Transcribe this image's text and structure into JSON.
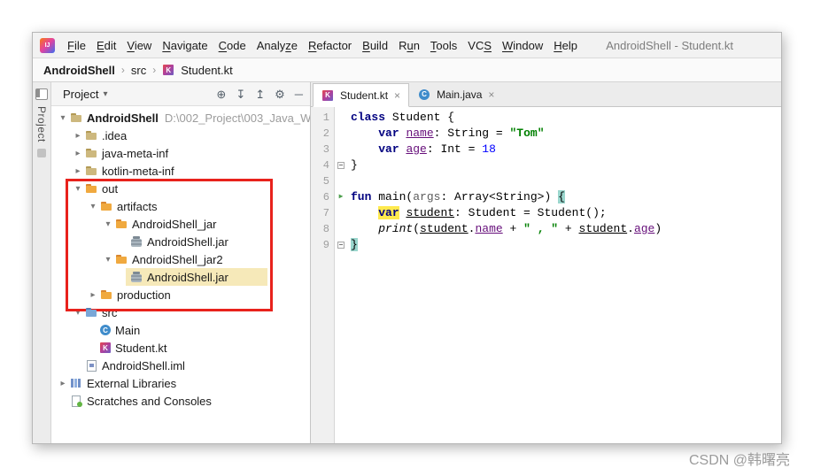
{
  "window": {
    "title": "AndroidShell - Student.kt",
    "logo_text": "IJ"
  },
  "menu": {
    "items": [
      {
        "label": "File",
        "mnemonic": 0
      },
      {
        "label": "Edit",
        "mnemonic": 0
      },
      {
        "label": "View",
        "mnemonic": 0
      },
      {
        "label": "Navigate",
        "mnemonic": 0
      },
      {
        "label": "Code",
        "mnemonic": 0
      },
      {
        "label": "Analyze",
        "mnemonic": 5
      },
      {
        "label": "Refactor",
        "mnemonic": 0
      },
      {
        "label": "Build",
        "mnemonic": 0
      },
      {
        "label": "Run",
        "mnemonic": 1
      },
      {
        "label": "Tools",
        "mnemonic": 0
      },
      {
        "label": "VCS",
        "mnemonic": 2
      },
      {
        "label": "Window",
        "mnemonic": 0
      },
      {
        "label": "Help",
        "mnemonic": 0
      }
    ]
  },
  "breadcrumb": {
    "separator": "›",
    "items": [
      {
        "label": "AndroidShell",
        "bold": true
      },
      {
        "label": "src"
      },
      {
        "label": "Student.kt",
        "icon": "kotlin"
      }
    ]
  },
  "tool_window_bar": {
    "label": "Project"
  },
  "project_panel": {
    "title": "Project",
    "dropdown_glyph": "▾",
    "toolbar_icons": [
      {
        "name": "locate-icon",
        "glyph": "⊕"
      },
      {
        "name": "expand-all-icon",
        "glyph": "↧"
      },
      {
        "name": "collapse-all-icon",
        "glyph": "↥"
      },
      {
        "name": "settings-icon",
        "glyph": "⚙"
      },
      {
        "name": "hide-icon",
        "glyph": "─"
      }
    ],
    "tree": [
      {
        "label": "AndroidShell",
        "suffix": "D:\\002_Project\\003_Java_W",
        "icon": "folder",
        "indent": 0,
        "state": "expanded",
        "bold": true
      },
      {
        "label": ".idea",
        "icon": "folder",
        "indent": 1,
        "state": "collapsed"
      },
      {
        "label": "java-meta-inf",
        "icon": "folder",
        "indent": 1,
        "state": "collapsed"
      },
      {
        "label": "kotlin-meta-inf",
        "icon": "folder",
        "indent": 1,
        "state": "collapsed"
      },
      {
        "label": "out",
        "icon": "folder-excluded",
        "indent": 1,
        "state": "expanded"
      },
      {
        "label": "artifacts",
        "icon": "folder-excluded",
        "indent": 2,
        "state": "expanded"
      },
      {
        "label": "AndroidShell_jar",
        "icon": "folder-excluded",
        "indent": 3,
        "state": "expanded"
      },
      {
        "label": "AndroidShell.jar",
        "icon": "jar",
        "indent": 4
      },
      {
        "label": "AndroidShell_jar2",
        "icon": "folder-excluded",
        "indent": 3,
        "state": "expanded"
      },
      {
        "label": "AndroidShell.jar",
        "icon": "jar",
        "indent": 4,
        "selected": true
      },
      {
        "label": "production",
        "icon": "folder-excluded",
        "indent": 2,
        "state": "collapsed"
      },
      {
        "label": "src",
        "icon": "folder-src",
        "indent": 1,
        "state": "expanded"
      },
      {
        "label": "Main",
        "icon": "class",
        "indent": 2
      },
      {
        "label": "Student.kt",
        "icon": "kotlin",
        "indent": 2
      },
      {
        "label": "AndroidShell.iml",
        "icon": "module-file",
        "indent": 1
      },
      {
        "label": "External Libraries",
        "icon": "libraries",
        "indent": 0,
        "state": "collapsed"
      },
      {
        "label": "Scratches and Consoles",
        "icon": "scratches",
        "indent": 0
      }
    ]
  },
  "editor": {
    "tabs": [
      {
        "label": "Student.kt",
        "icon": "kotlin",
        "selected": true,
        "close_glyph": "×"
      },
      {
        "label": "Main.java",
        "icon": "class",
        "selected": false,
        "close_glyph": "×"
      }
    ],
    "run_glyph": "▶",
    "lines": [
      {
        "num": 1,
        "tokens": [
          {
            "t": "class",
            "c": "kw"
          },
          {
            "t": " Student {"
          }
        ]
      },
      {
        "num": 2,
        "tokens": [
          {
            "t": "    "
          },
          {
            "t": "var",
            "c": "kw"
          },
          {
            "t": " "
          },
          {
            "t": "name",
            "c": "prop"
          },
          {
            "t": ": String = "
          },
          {
            "t": "\"Tom\"",
            "c": "str"
          }
        ]
      },
      {
        "num": 3,
        "tokens": [
          {
            "t": "    "
          },
          {
            "t": "var",
            "c": "kw"
          },
          {
            "t": " "
          },
          {
            "t": "age",
            "c": "prop"
          },
          {
            "t": ": Int = "
          },
          {
            "t": "18",
            "c": "num"
          }
        ]
      },
      {
        "num": 4,
        "gutter": "fold",
        "tokens": [
          {
            "t": "}"
          }
        ]
      },
      {
        "num": 5,
        "tokens": []
      },
      {
        "num": 6,
        "gutter": "run",
        "tokens": [
          {
            "t": "fun",
            "c": "kw"
          },
          {
            "t": " main("
          },
          {
            "t": "args",
            "c": "param"
          },
          {
            "t": ": Array<String>) "
          },
          {
            "t": "{",
            "c": "brace"
          }
        ]
      },
      {
        "num": 7,
        "tokens": [
          {
            "t": "    "
          },
          {
            "t": "var",
            "c": "kw word-hl"
          },
          {
            "t": " "
          },
          {
            "t": "student",
            "c": "local"
          },
          {
            "t": ": Student = Student();"
          }
        ]
      },
      {
        "num": 8,
        "tokens": [
          {
            "t": "    "
          },
          {
            "t": "print",
            "c": "fn"
          },
          {
            "t": "("
          },
          {
            "t": "student",
            "c": "local"
          },
          {
            "t": "."
          },
          {
            "t": "name",
            "c": "prop"
          },
          {
            "t": " + "
          },
          {
            "t": "\" , \"",
            "c": "str"
          },
          {
            "t": " + "
          },
          {
            "t": "student",
            "c": "local"
          },
          {
            "t": "."
          },
          {
            "t": "age",
            "c": "prop"
          },
          {
            "t": ")"
          }
        ]
      },
      {
        "num": 9,
        "gutter": "fold",
        "tokens": [
          {
            "t": "}",
            "c": "brace"
          }
        ]
      }
    ]
  },
  "watermark": "CSDN @韩曙亮",
  "colors": {
    "keyword": "#000080",
    "string": "#008000",
    "number": "#0000ff",
    "property": "#660e7a",
    "annotation_box": "#e8221c",
    "selection": "#f6e9b9",
    "brace_highlight": "#9ad6cd",
    "word_highlight": "#ffe94e"
  }
}
